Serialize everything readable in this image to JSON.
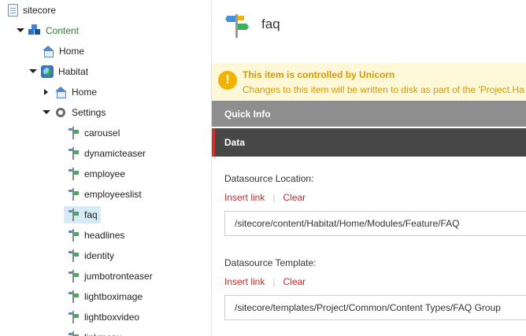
{
  "tree": {
    "items": [
      {
        "label": "sitecore",
        "icon": "document-icon"
      },
      {
        "label": "Content",
        "icon": "content-cubes-icon"
      },
      {
        "label": "Home",
        "icon": "home-icon"
      },
      {
        "label": "Habitat",
        "icon": "globe-icon"
      },
      {
        "label": "Home",
        "icon": "home-icon"
      },
      {
        "label": "Settings",
        "icon": "gear-icon"
      },
      {
        "label": "carousel",
        "icon": "signpost-icon"
      },
      {
        "label": "dynamicteaser",
        "icon": "signpost-icon"
      },
      {
        "label": "employee",
        "icon": "signpost-icon"
      },
      {
        "label": "employeeslist",
        "icon": "signpost-icon"
      },
      {
        "label": "faq",
        "icon": "signpost-icon"
      },
      {
        "label": "headlines",
        "icon": "signpost-icon"
      },
      {
        "label": "identity",
        "icon": "signpost-icon"
      },
      {
        "label": "jumbotronteaser",
        "icon": "signpost-icon"
      },
      {
        "label": "lightboximage",
        "icon": "signpost-icon"
      },
      {
        "label": "lightboxvideo",
        "icon": "signpost-icon"
      },
      {
        "label": "linkmenu",
        "icon": "signpost-icon"
      }
    ],
    "selected": "faq"
  },
  "header": {
    "title": "faq",
    "icon": "signpost-icon"
  },
  "warning": {
    "title": "This item is controlled by Unicorn",
    "text": "Changes to this item will be written to disk as part of the 'Project.Ha",
    "icon_symbol": "!"
  },
  "sections": {
    "quick_info": "Quick Info",
    "data": "Data"
  },
  "fields": {
    "datasource_location": {
      "label": "Datasource Location:",
      "insert_link": "Insert link",
      "clear": "Clear",
      "value": "/sitecore/content/Habitat/Home/Modules/Feature/FAQ"
    },
    "datasource_template": {
      "label": "Datasource Template:",
      "insert_link": "Insert link",
      "clear": "Clear",
      "value": "/sitecore/templates/Project/Common/Content Types/FAQ Group"
    }
  },
  "colors": {
    "accent": "#d32f2f",
    "warning": "#f0b400",
    "selected_bg": "#d6ebf7"
  }
}
